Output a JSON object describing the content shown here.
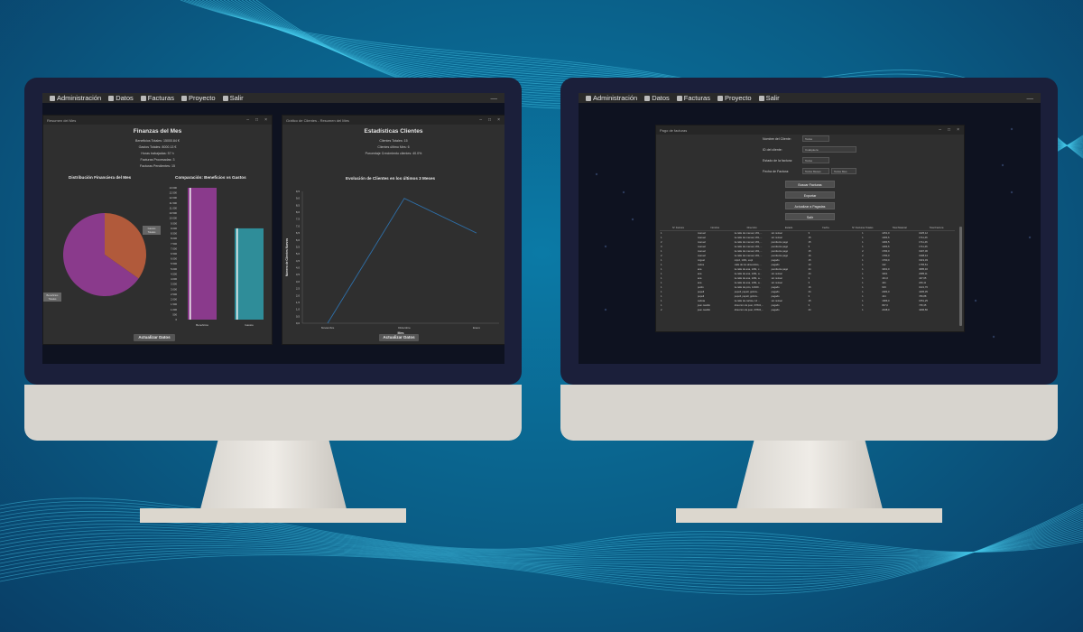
{
  "colors": {
    "purple": "#8a3a8c",
    "orange": "#b15a3b",
    "teal": "#2f8d99",
    "line": "#2f6fa8"
  },
  "menu": [
    {
      "label": "Administración",
      "icon": "admin-icon"
    },
    {
      "label": "Datos",
      "icon": "data-icon"
    },
    {
      "label": "Facturas",
      "icon": "invoice-icon"
    },
    {
      "label": "Proyecto",
      "icon": "project-icon"
    },
    {
      "label": "Salir",
      "icon": "exit-icon"
    }
  ],
  "left": {
    "finance": {
      "window_title": "Resumen del Mes",
      "heading": "Finanzas del Mes",
      "stats": [
        "Beneficios Totales:  15000.84 €",
        "Gastos Totales:  8000.13 €",
        "Horas trabajadas:  57 h",
        "Facturas Procesadas:  3",
        "Facturas Pendientes:  15"
      ],
      "pie_title": "Distribución Financiera del Mes",
      "pie_labels": [
        "Gastos Totales",
        "Beneficios Totales"
      ],
      "bar_title": "Comparación: Beneficios vs Gastos",
      "button": "Actualizar Datos"
    },
    "clients": {
      "window_title": "Gráfico de Clientes - Resumen del Mes",
      "heading": "Estadísticas Clientes",
      "stats": [
        "Clientes Totales:  15",
        "Clientes último Mes:  6",
        "Porcentaje Crecimiento clientes:  40.0%"
      ],
      "chart_title": "Evolución de Clientes en los últimos 3 Meses",
      "xlabel": "Mes",
      "ylabel": "Número de Clientes Nuevos",
      "button": "Actualizar Datos"
    }
  },
  "chart_data": [
    {
      "type": "pie",
      "title": "Distribución Financiera del Mes",
      "labels": [
        "Gastos Totales",
        "Beneficios Totales"
      ],
      "values": [
        8000.13,
        15000.84
      ]
    },
    {
      "type": "bar",
      "title": "Comparación: Beneficios vs Gastos",
      "categories": [
        "Beneficios",
        "Gastos"
      ],
      "values": [
        13000,
        9000
      ],
      "ylim": [
        0,
        13000
      ],
      "yticks": [
        "0",
        "500",
        "1.000",
        "1.500",
        "2.000",
        "2.500",
        "3.000",
        "3.500",
        "4.000",
        "4.500",
        "5.000",
        "5.500",
        "6.000",
        "6.500",
        "7.000",
        "7.500",
        "8.000",
        "8.500",
        "9.000",
        "9.500",
        "10.000",
        "10.500",
        "11.000",
        "11.500",
        "12.000",
        "12.500",
        "13.000"
      ]
    },
    {
      "type": "line",
      "title": "Evolución de Clientes en los últimos 3 Meses",
      "xlabel": "Mes",
      "ylabel": "Número de Clientes Nuevos",
      "categories": [
        "Noviembre",
        "Diciembre",
        "Enero"
      ],
      "values": [
        0,
        9,
        6.5
      ],
      "ylim": [
        0,
        9.5
      ],
      "yticks": [
        "0,0",
        "0,5",
        "1,0",
        "1,5",
        "2,0",
        "2,5",
        "3,0",
        "3,5",
        "4,0",
        "4,5",
        "5,0",
        "5,5",
        "6,0",
        "6,5",
        "7,0",
        "7,5",
        "8,0",
        "8,5",
        "9,0",
        "9,5"
      ]
    }
  ],
  "right": {
    "facturas": {
      "window_title": "Pago de facturas",
      "filters": [
        {
          "label": "Nombre del Cliente:",
          "value": "Todos"
        },
        {
          "label": "ID del cliente:",
          "value": "Cualquiera"
        },
        {
          "label": "Estado de la factura:",
          "value": "Todos"
        }
      ],
      "date_label": "Fecha de Factura:",
      "date_from": "Todos Meses",
      "date_to": "Todos Mes",
      "buttons": [
        "Buscar Facturas",
        "Exportar",
        "Actualizar a Pagadas",
        "Salir"
      ],
      "columns": [
        "Nº Factura",
        "Nombre",
        "Dirección",
        "Estado",
        "Fecha",
        "Nº Facturas Totales",
        "Total Material",
        "Total Factura"
      ],
      "rows": [
        [
          "1",
          "manuel",
          "la calle de manuel, 261,...",
          "sin revisar",
          "3",
          "1",
          "1451,0",
          "1625,12"
        ],
        [
          "1",
          "manuel",
          "la calle de manuel, 261,...",
          "sin revisar",
          "15",
          "1",
          "1484,6",
          "1711,46"
        ],
        [
          "2",
          "manuel",
          "la calle de manuel, 261,...",
          "pendiente pago",
          "15",
          "1",
          "1484,5",
          "1711,46"
        ],
        [
          "3",
          "manuel",
          "la calle de manuel, 261,...",
          "pendiente pago",
          "3",
          "1",
          "1484,6",
          "1711,46"
        ],
        [
          "1",
          "manuel",
          "la calle de manuel, 261,...",
          "pendiente pago",
          "15",
          "2",
          "1784,0",
          "1997,06"
        ],
        [
          "2",
          "manuel",
          "la calle de manuel, 261,...",
          "pendiente pago",
          "16",
          "2",
          "1784,0",
          "1998,44"
        ],
        [
          "1",
          "miguel",
          "mipcl, 1301, espl",
          "pagado",
          "15",
          "1",
          "1760,0",
          "1919,03"
        ],
        [
          "1",
          "carlos",
          "calle de los almendros,...",
          "pagado",
          "13",
          "1",
          "112",
          "1765,61"
        ],
        [
          "1",
          "ana",
          "la calle de ana, 1291, c...",
          "pendiente pago",
          "44",
          "1",
          "3261,0",
          "3685,46"
        ],
        [
          "1",
          "ana",
          "la calle de ana, 1291, a...",
          "sin revisar",
          "44",
          "1",
          "3261",
          "2385,11"
        ],
        [
          "1",
          "ana",
          "la calle de ana, 1291, a...",
          "sin revisar",
          "3",
          "1",
          "441,0",
          "447,05"
        ],
        [
          "1",
          "ana",
          "la calle de ana, 1291, a...",
          "sin revisar",
          "3",
          "1",
          "421",
          "226,11"
        ],
        [
          "1",
          "pedro",
          "la calle de pico, 12020...",
          "pagado",
          "16",
          "1",
          "919",
          "1021,76"
        ],
        [
          "1",
          "pepell",
          "pepell, pepell, ppbcw...",
          "pagado",
          "44",
          "1",
          "2284,0",
          "4405,35"
        ],
        [
          "1",
          "pepell",
          "pepell, pepell, ppbcw...",
          "pagado",
          "3",
          "1",
          "444",
          "789,88"
        ],
        [
          "1",
          "carlota",
          "la calle de carlota, 14 ...",
          "sin revisar",
          "15",
          "1",
          "1686,0",
          "1551,25"
        ],
        [
          "1",
          "juan castillo",
          "direccion de juan, 67834,...",
          "pagado",
          "3",
          "1",
          "837,0",
          "735,35"
        ],
        [
          "2",
          "juan castillo",
          "direccion de juan, 67834,...",
          "pagado",
          "44",
          "1",
          "2238,0",
          "4296,66"
        ]
      ]
    }
  }
}
